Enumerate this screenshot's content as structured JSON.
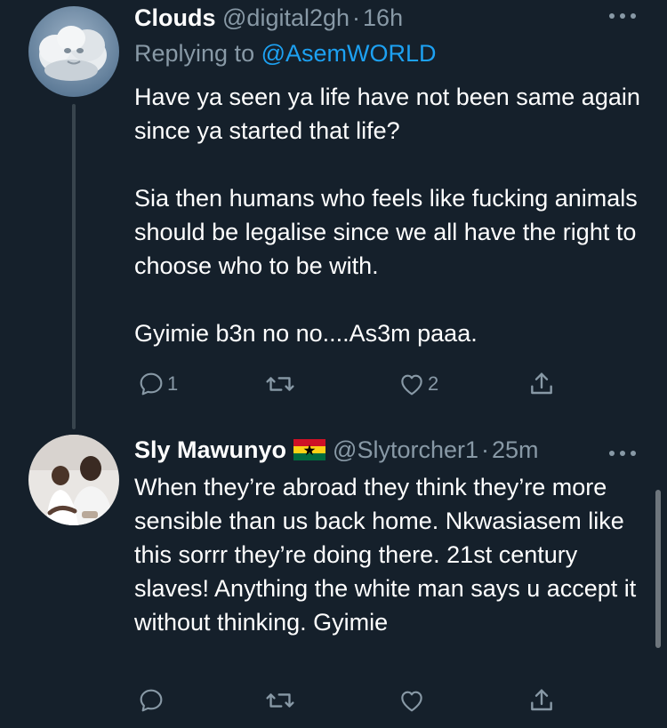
{
  "theme": {
    "background": "#15202b",
    "text": "#ffffff",
    "secondary_text": "#8899a6",
    "link": "#1da1f2",
    "thread_line": "#38444d"
  },
  "tweets": [
    {
      "display_name": "Clouds",
      "handle": "@digital2gh",
      "separator": "·",
      "time": "16h",
      "replying_prefix": "Replying to",
      "replying_to": "@AsemWORLD",
      "avatar_icon": "cloud-face-avatar",
      "body": [
        "Have ya seen ya life have not been same again since ya started that life?",
        "Sia then humans who feels like fucking animals should be legalise since we all have the right to choose who to be with.",
        "Gyimie b3n no no....As3m paaa."
      ],
      "actions": {
        "reply_count": "1",
        "retweet_count": "",
        "like_count": "2"
      }
    },
    {
      "display_name": "Sly Mawunyo",
      "flag": "ghana-flag",
      "handle": "@Slytorcher1",
      "separator": "·",
      "time": "25m",
      "avatar_icon": "man-with-child-avatar",
      "body": [
        "When they’re abroad they think they’re more sensible than us back home. Nkwasiasem like this sorrr they’re doing there. 21st century slaves! Anything the white man says u accept it without thinking. Gyimie"
      ],
      "actions": {
        "reply_count": "",
        "retweet_count": "",
        "like_count": ""
      }
    }
  ]
}
